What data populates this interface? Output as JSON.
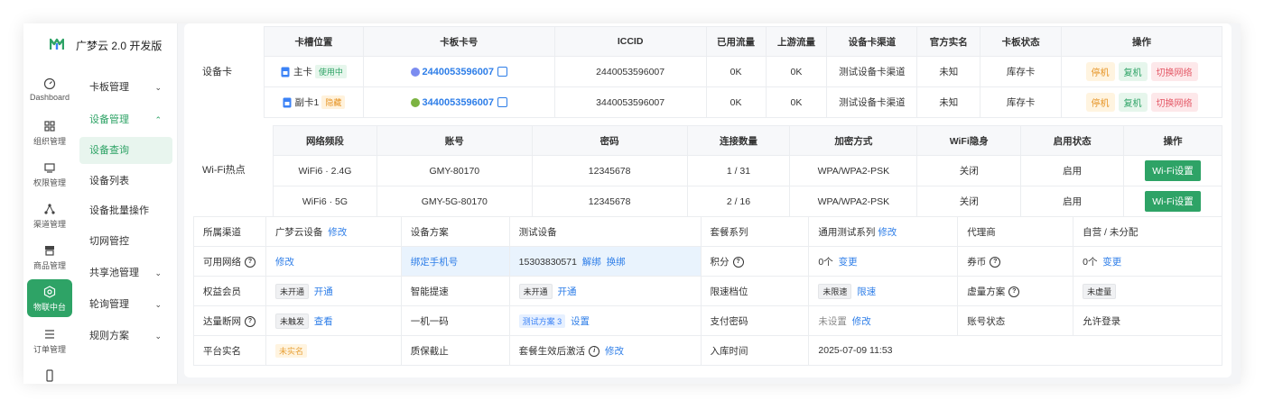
{
  "brand": "广梦云 2.0 开发版",
  "rail": [
    {
      "label": "Dashboard",
      "icon": "dashboard-icon"
    },
    {
      "label": "组织管理",
      "icon": "grid-icon"
    },
    {
      "label": "权限管理",
      "icon": "monitor-icon"
    },
    {
      "label": "渠道管理",
      "icon": "network-icon"
    },
    {
      "label": "商品管理",
      "icon": "store-icon"
    },
    {
      "label": "物联中台",
      "icon": "iot-icon",
      "active": true
    },
    {
      "label": "订单管理",
      "icon": "list-icon"
    },
    {
      "label": "",
      "icon": "phone-icon"
    }
  ],
  "submenu": {
    "card_mgmt": "卡板管理",
    "device_mgmt": "设备管理",
    "device_query": "设备查询",
    "device_list": "设备列表",
    "device_batch": "设备批量操作",
    "net_switch": "切网管控",
    "pool_mgmt": "共享池管理",
    "poll_mgmt": "轮询管理",
    "rule_plan": "规则方案"
  },
  "device_card": {
    "label": "设备卡",
    "headers": [
      "卡槽位置",
      "卡板卡号",
      "ICCID",
      "已用流量",
      "上游流量",
      "设备卡渠道",
      "官方实名",
      "卡板状态",
      "操作"
    ],
    "rows": [
      {
        "slot": "主卡",
        "slot_tag": "使用中",
        "card_no": "2440053596007",
        "iccid": "2440053596007",
        "used": "0K",
        "upstream": "0K",
        "channel": "测试设备卡渠道",
        "realname": "未知",
        "status": "库存卡"
      },
      {
        "slot": "副卡1",
        "slot_tag": "隐藏",
        "card_no": "3440053596007",
        "iccid": "3440053596007",
        "used": "0K",
        "upstream": "0K",
        "channel": "测试设备卡渠道",
        "realname": "未知",
        "status": "库存卡"
      }
    ],
    "actions": {
      "stop": "停机",
      "resume": "复机",
      "switch": "切换网络"
    }
  },
  "wifi": {
    "label": "Wi-Fi热点",
    "headers": [
      "网络频段",
      "账号",
      "密码",
      "连接数量",
      "加密方式",
      "WiFi隐身",
      "启用状态",
      "操作"
    ],
    "rows": [
      {
        "band": "WiFi6 · 2.4G",
        "account": "GMY-80170",
        "password": "12345678",
        "conn": "1 / 31",
        "enc": "WPA/WPA2-PSK",
        "hidden": "关闭",
        "enabled": "启用"
      },
      {
        "band": "WiFi6 · 5G",
        "account": "GMY-5G-80170",
        "password": "12345678",
        "conn": "2 / 16",
        "enc": "WPA/WPA2-PSK",
        "hidden": "关闭",
        "enabled": "启用"
      }
    ],
    "action": "Wi-Fi设置"
  },
  "info": {
    "channel_label": "所属渠道",
    "channel_value": "广梦云设备",
    "edit": "修改",
    "plan_label": "设备方案",
    "plan_value": "测试设备",
    "package_label": "套餐系列",
    "package_value": "通用测试系列",
    "agent_label": "代理商",
    "agent_value": "自营 / 未分配",
    "network_label": "可用网络",
    "bind_label": "绑定手机号",
    "bind_value": "15303830571",
    "unbind": "解绑",
    "rebind": "换绑",
    "points_label": "积分",
    "points_value": "0个",
    "change": "变更",
    "coupon_label": "券币",
    "coupon_value": "0个",
    "member_label": "权益会员",
    "not_open": "未开通",
    "open": "开通",
    "speed_label": "智能提速",
    "limit_label": "限速档位",
    "not_limited": "未限速",
    "limit_action": "限速",
    "virtual_label": "虚量方案",
    "not_virtual": "未虚量",
    "cut_label": "达量断网",
    "not_triggered": "未触发",
    "view": "查看",
    "onecode_label": "一机一码",
    "onecode_tag": "测试方案 3",
    "setting": "设置",
    "paypwd_label": "支付密码",
    "paypwd_value": "未设置",
    "account_status_label": "账号状态",
    "account_status_value": "允许登录",
    "realname_label": "平台实名",
    "realname_tag": "未实名",
    "warranty_label": "质保截止",
    "activate_label": "套餐生效后激活",
    "storage_label": "入库时间",
    "storage_value": "2025-07-09 11:53"
  }
}
